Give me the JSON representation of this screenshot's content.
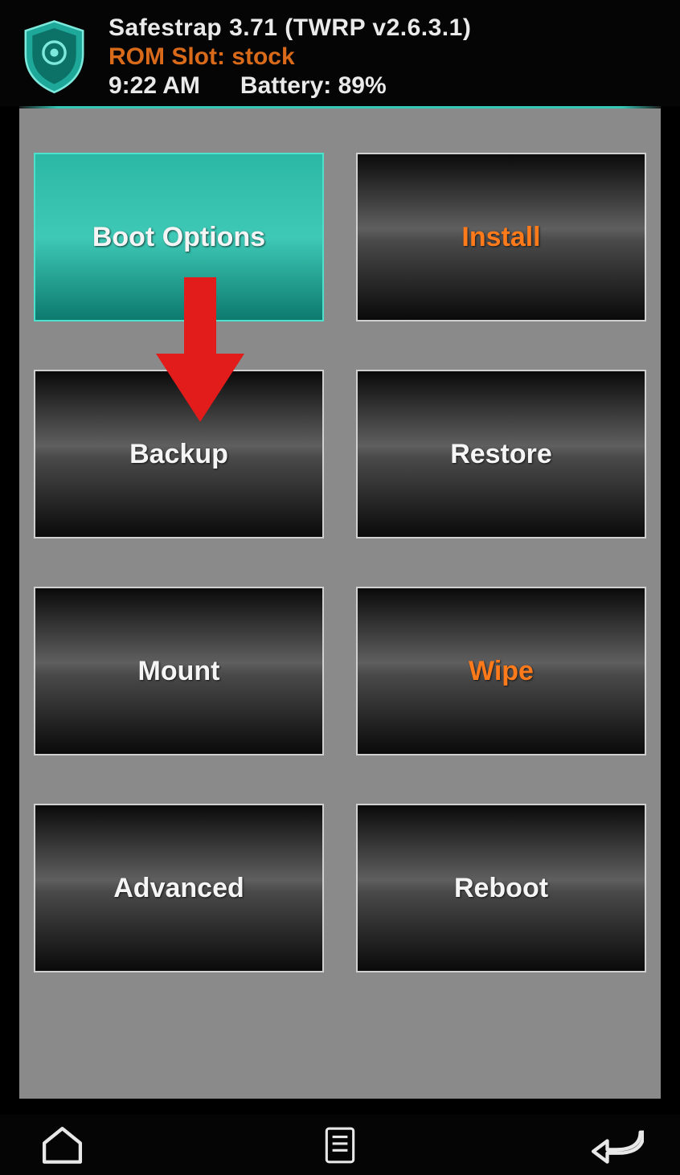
{
  "header": {
    "title": "Safestrap 3.71 (TWRP v2.6.3.1)",
    "rom_slot": "ROM Slot: stock",
    "time": "9:22 AM",
    "battery": "Battery: 89%"
  },
  "buttons": {
    "boot_options": "Boot Options",
    "install": "Install",
    "backup": "Backup",
    "restore": "Restore",
    "mount": "Mount",
    "wipe": "Wipe",
    "advanced": "Advanced",
    "reboot": "Reboot"
  },
  "annotation": {
    "arrow_target": "backup"
  },
  "colors": {
    "teal": "#2bb8a5",
    "orange": "#ff7a1a",
    "rom_orange": "#d96a1a",
    "bg_gray": "#8a8a8a"
  }
}
